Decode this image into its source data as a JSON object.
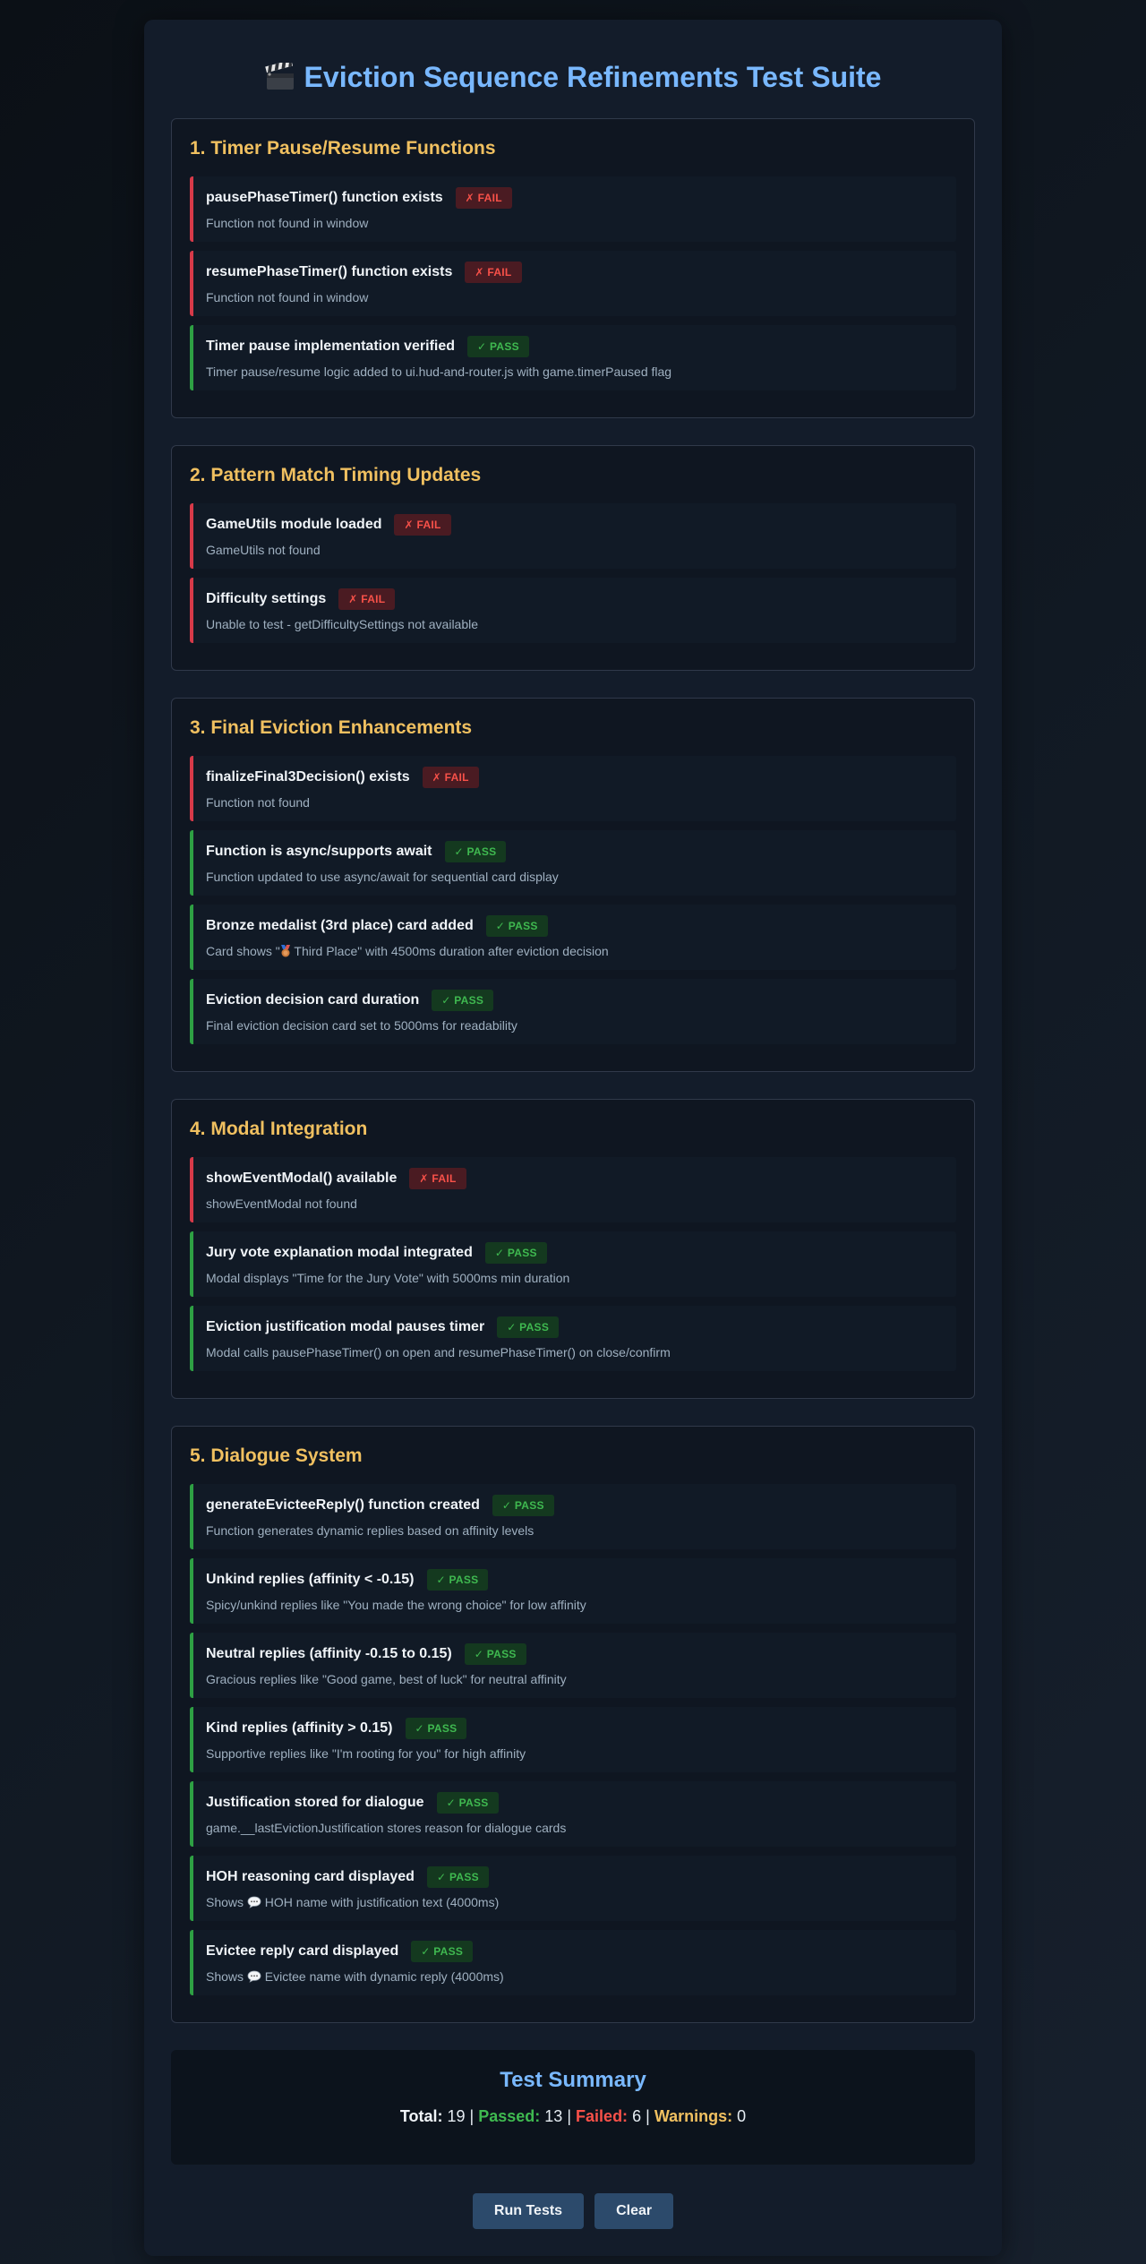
{
  "header": {
    "icon": "clapperboard-icon",
    "title": "Eviction Sequence Refinements Test Suite"
  },
  "status_labels": {
    "pass": "✓ PASS",
    "fail": "✗ FAIL"
  },
  "colors": {
    "pass": "#3fb950",
    "fail": "#f85149",
    "section_title": "#f0c060",
    "title": "#79b8ff"
  },
  "sections": [
    {
      "title": "1. Timer Pause/Resume Functions",
      "tests": [
        {
          "name": "pausePhaseTimer() function exists",
          "status": "fail",
          "desc": "Function not found in window"
        },
        {
          "name": "resumePhaseTimer() function exists",
          "status": "fail",
          "desc": "Function not found in window"
        },
        {
          "name": "Timer pause implementation verified",
          "status": "pass",
          "desc": "Timer pause/resume logic added to ui.hud-and-router.js with game.timerPaused flag"
        }
      ]
    },
    {
      "title": "2. Pattern Match Timing Updates",
      "tests": [
        {
          "name": "GameUtils module loaded",
          "status": "fail",
          "desc": "GameUtils not found"
        },
        {
          "name": "Difficulty settings",
          "status": "fail",
          "desc": "Unable to test - getDifficultySettings not available"
        }
      ]
    },
    {
      "title": "3. Final Eviction Enhancements",
      "tests": [
        {
          "name": "finalizeFinal3Decision() exists",
          "status": "fail",
          "desc": "Function not found"
        },
        {
          "name": "Function is async/supports await",
          "status": "pass",
          "desc": "Function updated to use async/await for sequential card display"
        },
        {
          "name": "Bronze medalist (3rd place) card added",
          "status": "pass",
          "desc_pre": "Card shows \"",
          "desc_icon": "bronze-medal-icon",
          "desc_post": " Third Place\" with 4500ms duration after eviction decision"
        },
        {
          "name": "Eviction decision card duration",
          "status": "pass",
          "desc": "Final eviction decision card set to 5000ms for readability"
        }
      ]
    },
    {
      "title": "4. Modal Integration",
      "tests": [
        {
          "name": "showEventModal() available",
          "status": "fail",
          "desc": "showEventModal not found"
        },
        {
          "name": "Jury vote explanation modal integrated",
          "status": "pass",
          "desc": "Modal displays \"Time for the Jury Vote\" with 5000ms min duration"
        },
        {
          "name": "Eviction justification modal pauses timer",
          "status": "pass",
          "desc": "Modal calls pausePhaseTimer() on open and resumePhaseTimer() on close/confirm"
        }
      ]
    },
    {
      "title": "5. Dialogue System",
      "tests": [
        {
          "name": "generateEvicteeReply() function created",
          "status": "pass",
          "desc": "Function generates dynamic replies based on affinity levels"
        },
        {
          "name": "Unkind replies (affinity < -0.15)",
          "status": "pass",
          "desc": "Spicy/unkind replies like \"You made the wrong choice\" for low affinity"
        },
        {
          "name": "Neutral replies (affinity -0.15 to 0.15)",
          "status": "pass",
          "desc": "Gracious replies like \"Good game, best of luck\" for neutral affinity"
        },
        {
          "name": "Kind replies (affinity > 0.15)",
          "status": "pass",
          "desc": "Supportive replies like \"I'm rooting for you\" for high affinity"
        },
        {
          "name": "Justification stored for dialogue",
          "status": "pass",
          "desc": "game.__lastEvictionJustification stores reason for dialogue cards"
        },
        {
          "name": "HOH reasoning card displayed",
          "status": "pass",
          "desc_pre": "Shows ",
          "desc_icon": "speech-bubble-icon",
          "desc_post": " HOH name with justification text (4000ms)"
        },
        {
          "name": "Evictee reply card displayed",
          "status": "pass",
          "desc_pre": "Shows ",
          "desc_icon": "speech-bubble-icon",
          "desc_post": " Evictee name with dynamic reply (4000ms)"
        }
      ]
    }
  ],
  "summary": {
    "title": "Test Summary",
    "total_label": "Total:",
    "total": "19",
    "passed_label": "Passed:",
    "passed": "13",
    "failed_label": "Failed:",
    "failed": "6",
    "warnings_label": "Warnings:",
    "warnings": "0",
    "separator": "|"
  },
  "buttons": {
    "run_label": "Run Tests",
    "clear_label": "Clear"
  }
}
